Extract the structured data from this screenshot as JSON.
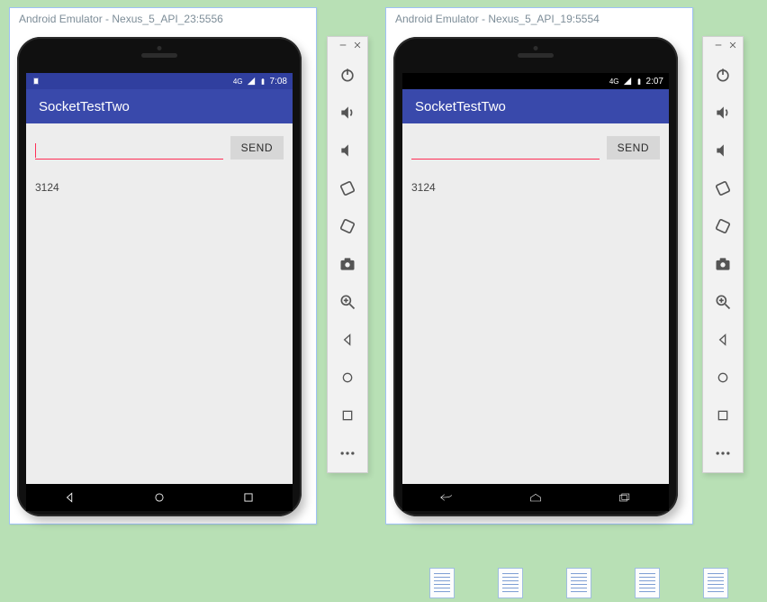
{
  "emu1": {
    "title": "Android Emulator - Nexus_5_API_23:5556",
    "time": "7:08",
    "net_label": "4G",
    "app_title": "SocketTestTwo",
    "input_value": "",
    "send_label": "SEND",
    "result": "3124"
  },
  "emu2": {
    "title": "Android Emulator - Nexus_5_API_19:5554",
    "time": "2:07",
    "net_label": "4G",
    "app_title": "SocketTestTwo",
    "input_value": "",
    "send_label": "SEND",
    "result": "3124"
  }
}
